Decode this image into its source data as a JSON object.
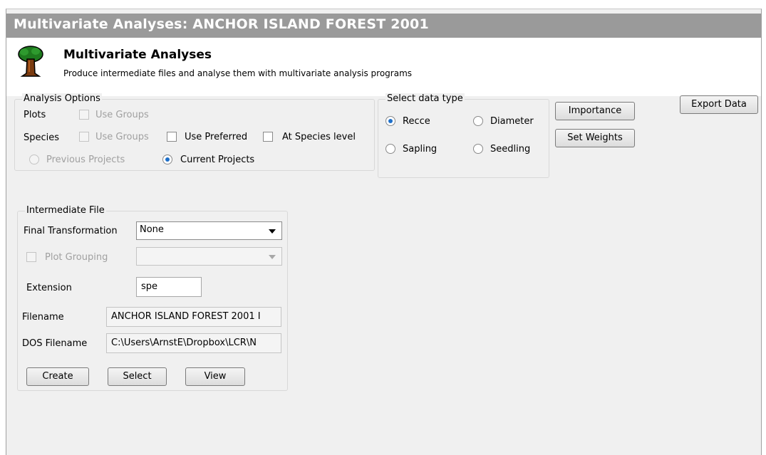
{
  "window": {
    "title": "Multivariate Analyses: ANCHOR ISLAND FOREST 2001"
  },
  "header": {
    "icon": "tree-icon",
    "title": "Multivariate Analyses",
    "subtitle": "Produce intermediate files and analyse them with multivariate analysis programs"
  },
  "analysis_options": {
    "legend": "Analysis Options",
    "plots_label": "Plots",
    "plots_use_groups": {
      "label": "Use Groups",
      "checked": false,
      "enabled": false
    },
    "species_label": "Species",
    "species_use_groups": {
      "label": "Use Groups",
      "checked": false,
      "enabled": false
    },
    "use_preferred": {
      "label": "Use Preferred",
      "checked": false
    },
    "at_species_level": {
      "label": "At Species level",
      "checked": false
    },
    "previous_projects": {
      "label": "Previous Projects",
      "selected": false,
      "enabled": false
    },
    "current_projects": {
      "label": "Current Projects",
      "selected": true
    }
  },
  "data_type": {
    "legend": "Select data type",
    "options": [
      {
        "label": "Recce",
        "selected": true
      },
      {
        "label": "Diameter",
        "selected": false
      },
      {
        "label": "Sapling",
        "selected": false
      },
      {
        "label": "Seedling",
        "selected": false
      }
    ]
  },
  "buttons": {
    "importance": "Importance",
    "set_weights": "Set Weights",
    "export_data": "Export Data"
  },
  "intermediate_file": {
    "legend": "Intermediate File",
    "final_transformation_label": "Final Transformation",
    "final_transformation_value": "None",
    "plot_grouping": {
      "label": "Plot Grouping",
      "checked": false,
      "enabled": false,
      "value": ""
    },
    "extension_label": "Extension",
    "extension_value": "spe",
    "filename_label": "Filename",
    "filename_value": "ANCHOR ISLAND FOREST 2001 I",
    "dos_filename_label": "DOS Filename",
    "dos_filename_value": "C:\\Users\\ArnstE\\Dropbox\\LCR\\N",
    "create_label": "Create",
    "select_label": "Select",
    "view_label": "View"
  }
}
